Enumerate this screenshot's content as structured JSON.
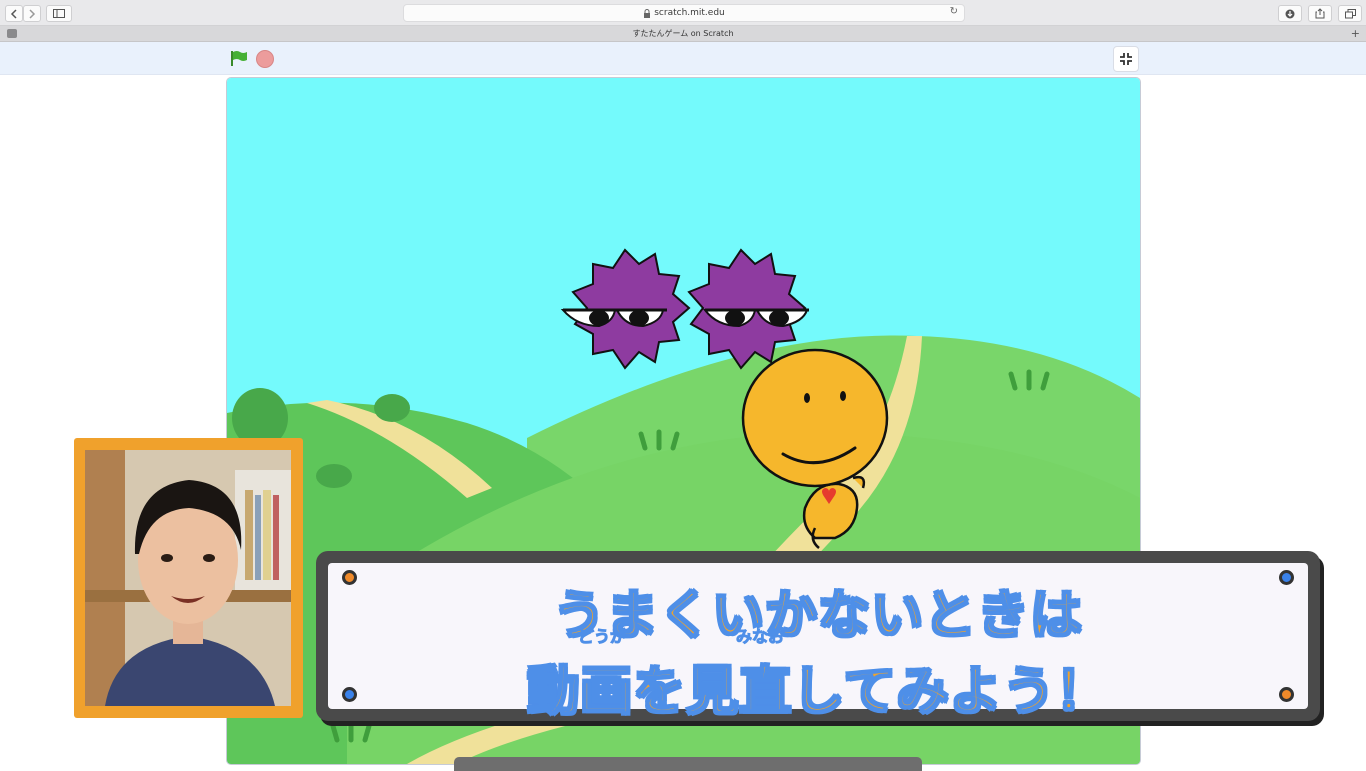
{
  "browser": {
    "url": "scratch.mit.edu",
    "tab_title": "すたたんゲーム on Scratch"
  },
  "caption": {
    "line1": "うまくいかないときは",
    "line2": "動画を見直してみよう！",
    "ruby_douga": "どうが",
    "ruby_minao": "みなお"
  },
  "colors": {
    "sky": "#74fafc",
    "hill_dark": "#5ec65a",
    "hill_light": "#79d66a",
    "path": "#f0e19a",
    "enemy": "#8e3ba0",
    "hero": "#f6b72c",
    "caption_text": "#f0a32a",
    "caption_outline": "#4e8fe8",
    "cam_frame": "#f0a12c"
  },
  "icons": {
    "back": "chevron-left-icon",
    "forward": "chevron-right-icon",
    "sidebar": "sidebar-icon",
    "lock": "lock-icon",
    "reload": "reload-icon",
    "download": "download-icon",
    "share": "share-icon",
    "tabs": "tabs-icon",
    "green_flag": "green-flag-icon",
    "stop": "stop-icon",
    "fullscreen_exit": "fullscreen-exit-icon"
  }
}
